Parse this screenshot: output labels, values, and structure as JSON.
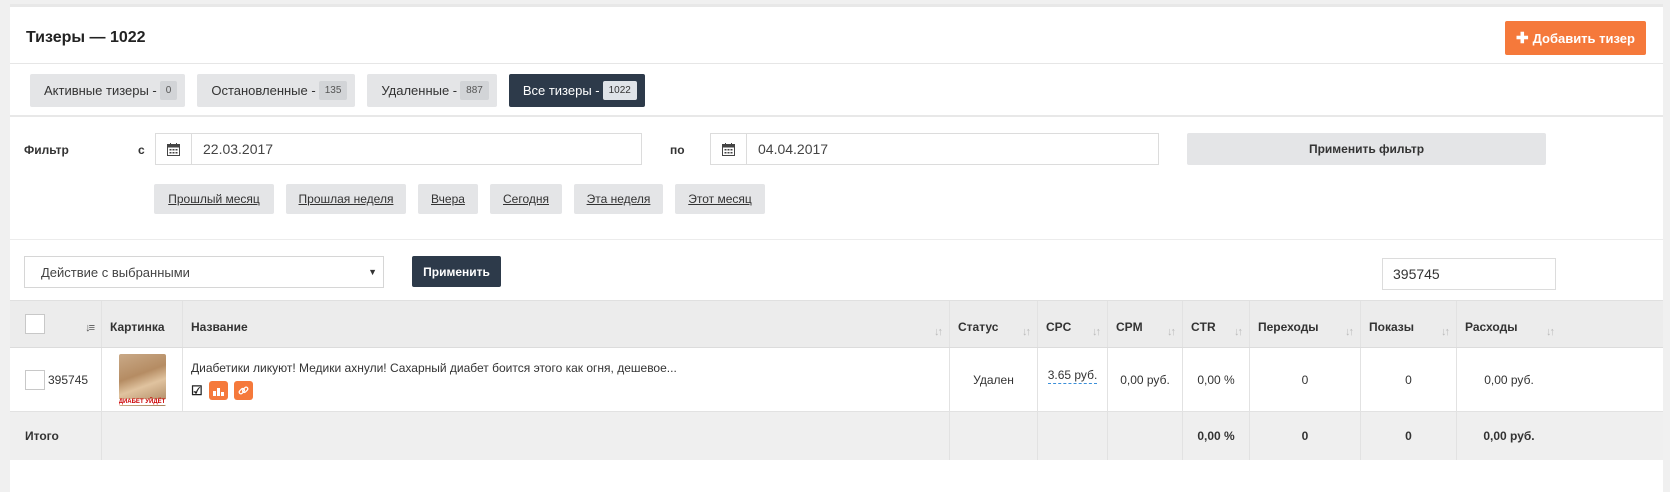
{
  "header": {
    "title": "Тизеры — 1022",
    "add_button": "Добавить тизер"
  },
  "tabs": [
    {
      "label": "Активные тизеры -",
      "count": "0"
    },
    {
      "label": "Остановленные -",
      "count": "135"
    },
    {
      "label": "Удаленные -",
      "count": "887"
    },
    {
      "label": "Все тизеры -",
      "count": "1022"
    }
  ],
  "filter": {
    "label": "Фильтр",
    "from_label": "с",
    "to_label": "по",
    "from_value": "22.03.2017",
    "to_value": "04.04.2017",
    "apply_label": "Применить фильтр",
    "quick": [
      "Прошлый месяц",
      "Прошлая неделя",
      "Вчера",
      "Сегодня",
      "Эта неделя",
      "Этот месяц"
    ]
  },
  "actions": {
    "select_value": "Действие с выбранными",
    "apply_label": "Применить",
    "search_value": "395745"
  },
  "table": {
    "headers": [
      "Картинка",
      "Название",
      "Статус",
      "CPC",
      "CPM",
      "CTR",
      "Переходы",
      "Показы",
      "Расходы"
    ],
    "row": {
      "id": "395745",
      "thumb_caption": "ДИАБЕТ УЙДЁТ",
      "name": "Диабетики ликуют! Медики ахнули! Сахарный диабет боится этого как огня, дешевое...",
      "status": "Удален",
      "cpc": "3.65 руб.",
      "cpm": "0,00 руб.",
      "ctr": "0,00 %",
      "clicks": "0",
      "views": "0",
      "spend": "0,00 руб."
    },
    "footer": {
      "label": "Итого",
      "ctr": "0,00 %",
      "clicks": "0",
      "views": "0",
      "spend": "0,00 руб."
    }
  },
  "colors": {
    "accent": "#f5793b",
    "dark": "#2d3a4a"
  }
}
